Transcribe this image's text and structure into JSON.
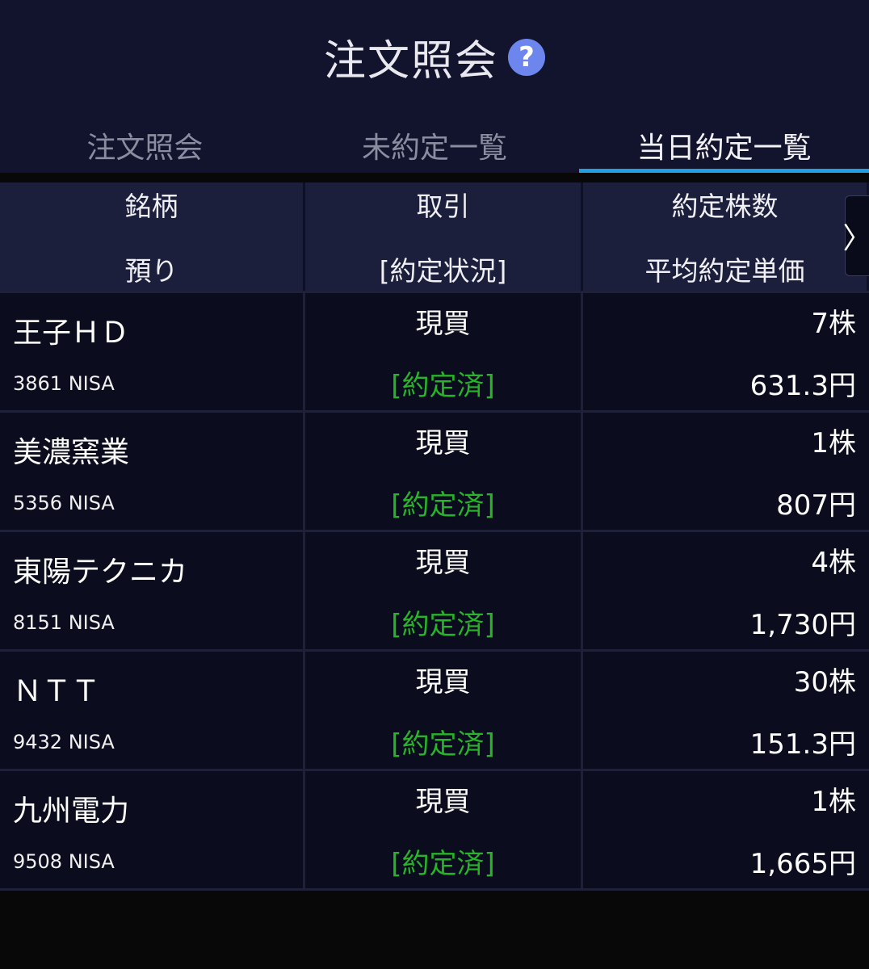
{
  "header": {
    "title": "注文照会",
    "help_icon": "?"
  },
  "tabs": [
    {
      "label": "注文照会",
      "active": false
    },
    {
      "label": "未約定一覧",
      "active": false
    },
    {
      "label": "当日約定一覧",
      "active": true
    }
  ],
  "columns": {
    "col1_line1": "銘柄",
    "col1_line2": "預り",
    "col2_line1": "取引",
    "col2_line2": "[約定状況]",
    "col3_line1": "約定株数",
    "col3_line2": "平均約定単価",
    "scroll_arrow": "〉"
  },
  "rows": [
    {
      "name": "王子ＨＤ",
      "code": "3861 NISA",
      "trade": "現買",
      "status": "[約定済]",
      "qty": "7株",
      "price": "631.3円"
    },
    {
      "name": "美濃窯業",
      "code": "5356 NISA",
      "trade": "現買",
      "status": "[約定済]",
      "qty": "1株",
      "price": "807円"
    },
    {
      "name": "東陽テクニカ",
      "code": "8151 NISA",
      "trade": "現買",
      "status": "[約定済]",
      "qty": "4株",
      "price": "1,730円"
    },
    {
      "name": "ＮＴＴ",
      "code": "9432 NISA",
      "trade": "現買",
      "status": "[約定済]",
      "qty": "30株",
      "price": "151.3円"
    },
    {
      "name": "九州電力",
      "code": "9508 NISA",
      "trade": "現買",
      "status": "[約定済]",
      "qty": "1株",
      "price": "1,665円"
    }
  ],
  "colors": {
    "status_green": "#28b428",
    "tab_underline": "#1fa0e0",
    "help_icon_bg": "#6d86ee"
  }
}
